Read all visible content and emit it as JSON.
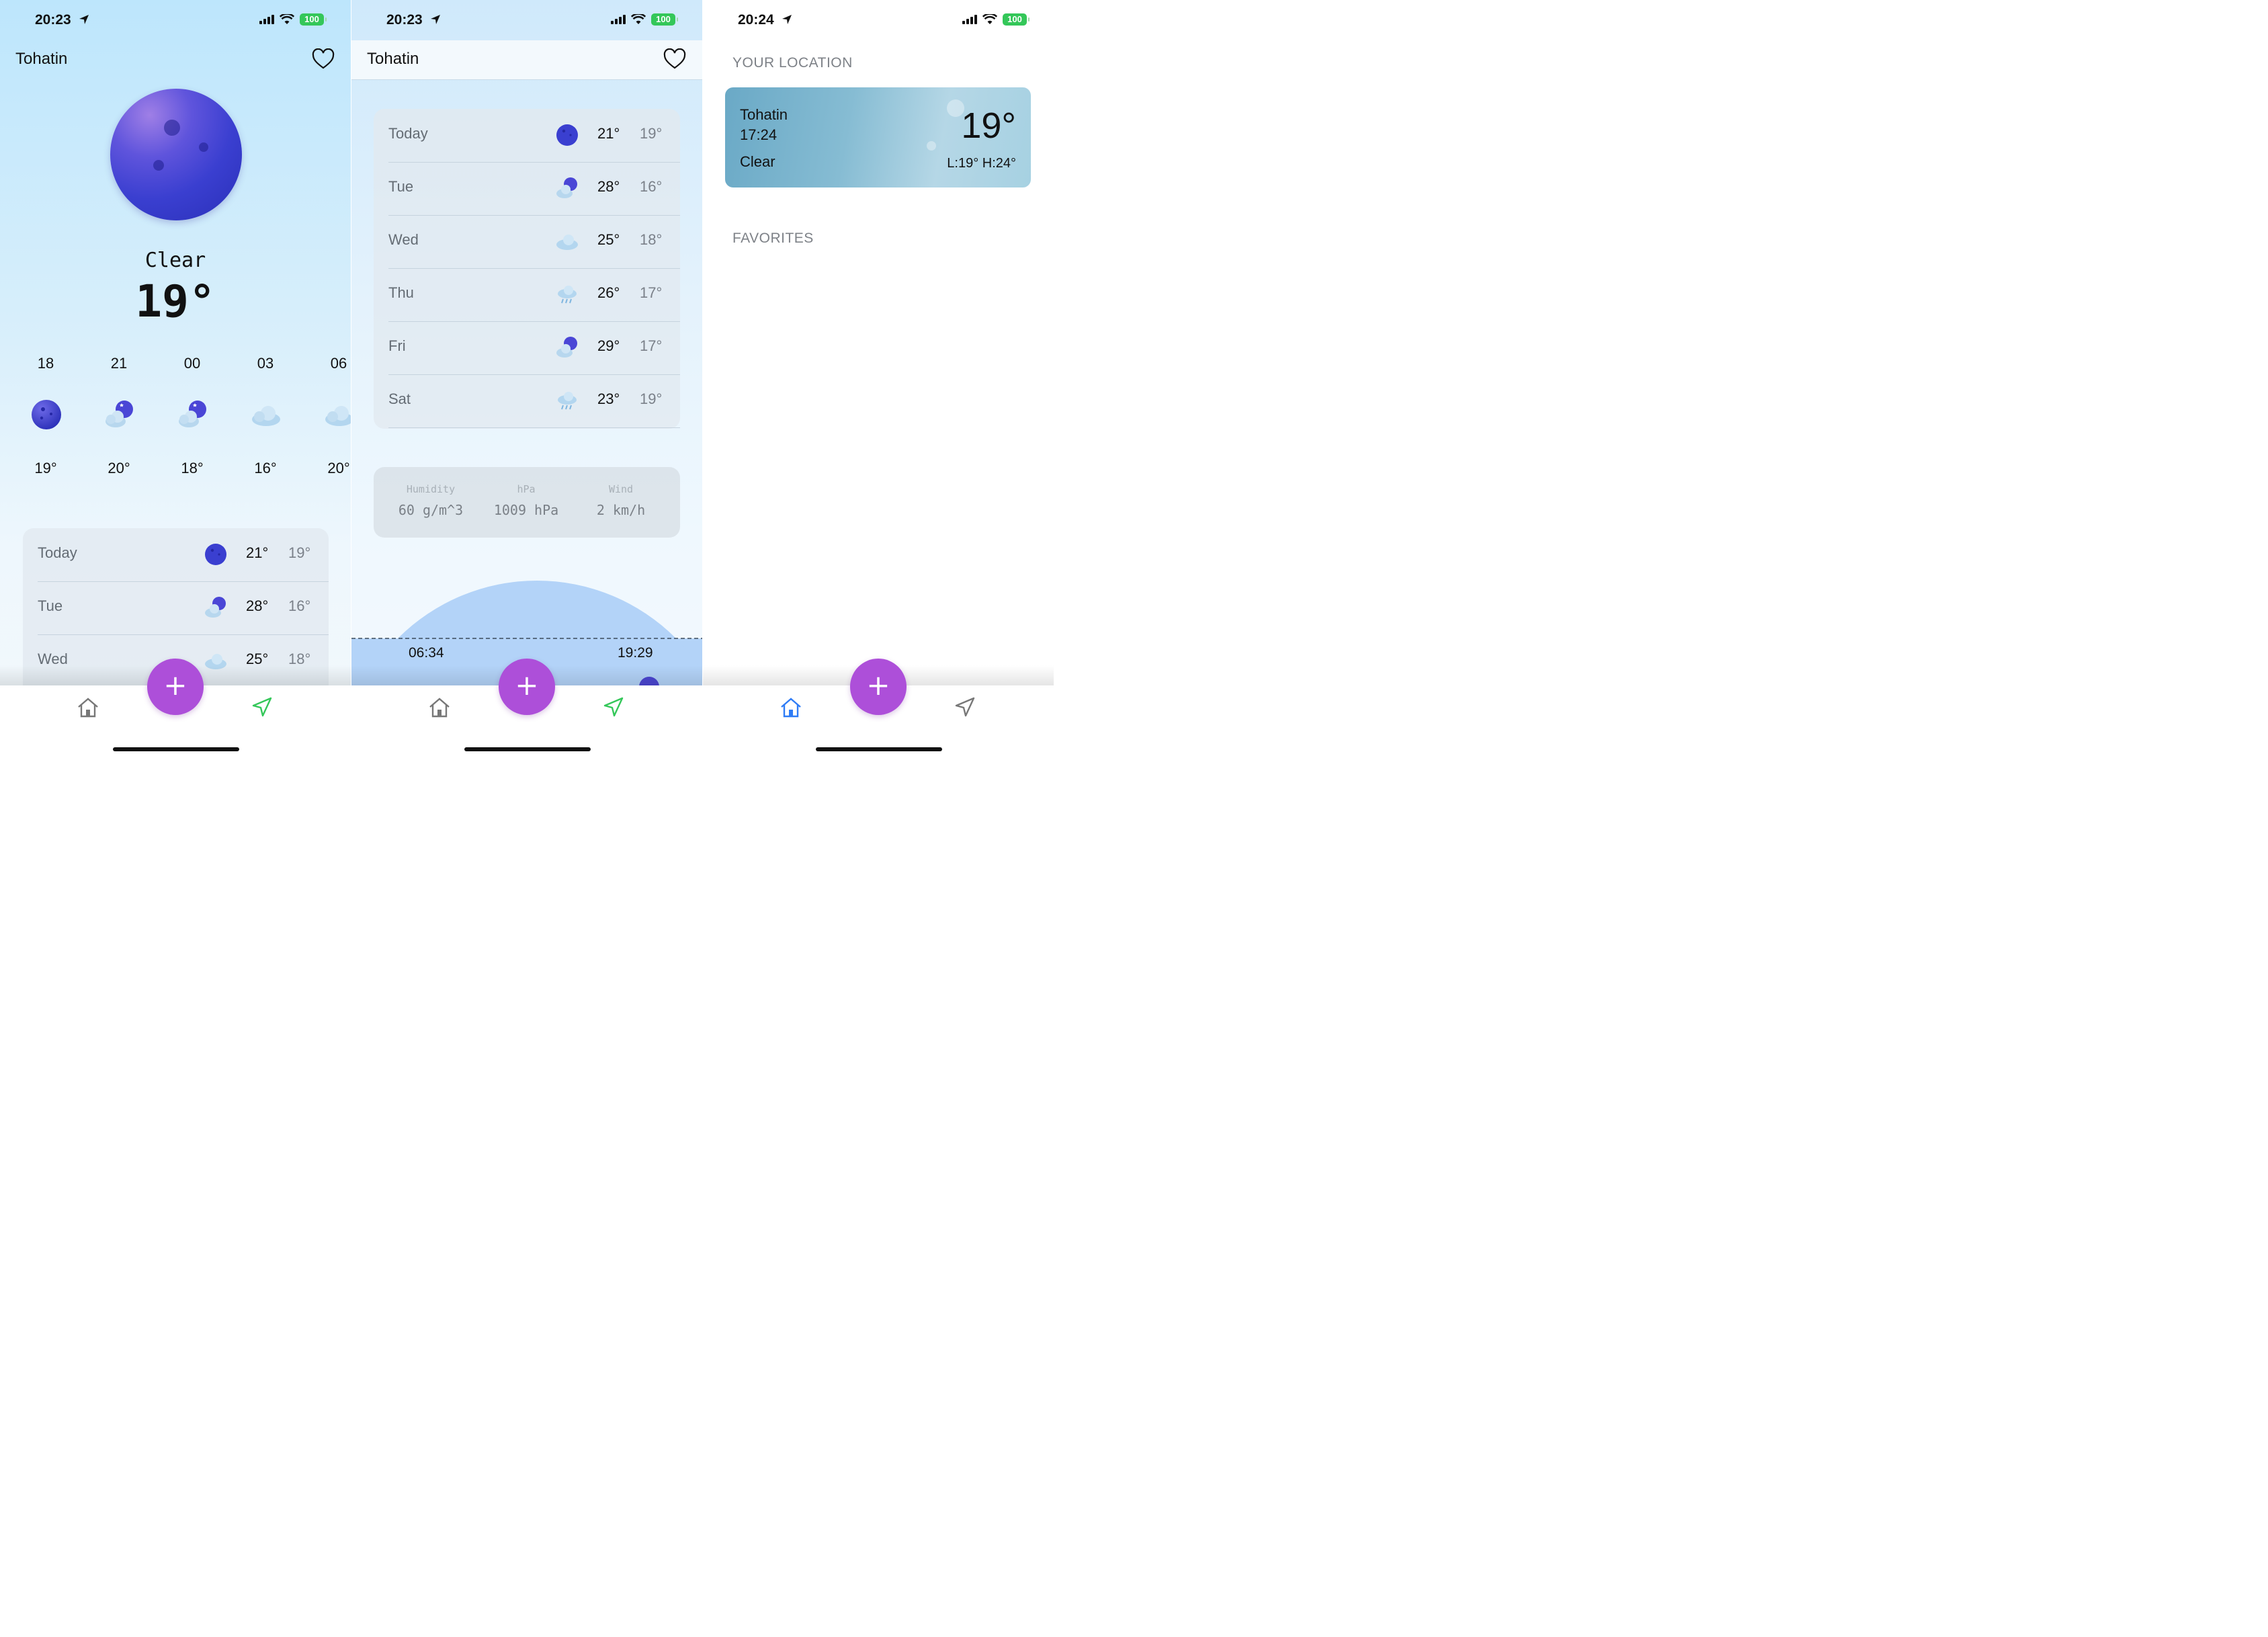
{
  "screens": [
    {
      "status": {
        "time": "20:23",
        "battery": "100"
      },
      "city": "Tohatin",
      "condition": "Clear",
      "temperature": "19°",
      "hourly": [
        {
          "hour": "18",
          "icon": "moon-icon",
          "temp": "19°"
        },
        {
          "hour": "21",
          "icon": "cloud-moon-icon",
          "temp": "20°"
        },
        {
          "hour": "00",
          "icon": "cloud-moon-icon",
          "temp": "18°"
        },
        {
          "hour": "03",
          "icon": "cloud-icon",
          "temp": "16°"
        },
        {
          "hour": "06",
          "icon": "cloud-icon",
          "temp": "20°"
        }
      ],
      "daily": [
        {
          "day": "Today",
          "icon": "moon-icon",
          "high": "21°",
          "low": "19°"
        },
        {
          "day": "Tue",
          "icon": "cloud-moon-icon",
          "high": "28°",
          "low": "16°"
        },
        {
          "day": "Wed",
          "icon": "cloud-icon",
          "high": "25°",
          "low": "18°"
        }
      ]
    },
    {
      "status": {
        "time": "20:23",
        "battery": "100"
      },
      "city": "Tohatin",
      "daily": [
        {
          "day": "Today",
          "icon": "moon-icon",
          "high": "21°",
          "low": "19°"
        },
        {
          "day": "Tue",
          "icon": "cloud-moon-icon",
          "high": "28°",
          "low": "16°"
        },
        {
          "day": "Wed",
          "icon": "cloud-icon",
          "high": "25°",
          "low": "18°"
        },
        {
          "day": "Thu",
          "icon": "rain-cloud-icon",
          "high": "26°",
          "low": "17°"
        },
        {
          "day": "Fri",
          "icon": "cloud-moon-icon",
          "high": "29°",
          "low": "17°"
        },
        {
          "day": "Sat",
          "icon": "rain-cloud-icon",
          "high": "23°",
          "low": "19°"
        }
      ],
      "stats": [
        {
          "label": "Humidity",
          "value": "60 g/m^3"
        },
        {
          "label": "hPa",
          "value": "1009 hPa"
        },
        {
          "label": "Wind",
          "value": "2 km/h"
        }
      ],
      "sunrise": "06:34",
      "sunset": "19:29"
    },
    {
      "status": {
        "time": "20:24",
        "battery": "100"
      },
      "your_location_label": "YOUR LOCATION",
      "location_card": {
        "city": "Tohatin",
        "time": "17:24",
        "condition": "Clear",
        "temperature": "19°",
        "low_high": "L:19° H:24°"
      },
      "favorites_label": "FAVORITES"
    }
  ],
  "nav": {
    "add_label": "+"
  },
  "colors": {
    "accent_fab": "#ad4fd9",
    "nav_active_home": "#2f7cf6",
    "nav_locate_green": "#34c759"
  }
}
